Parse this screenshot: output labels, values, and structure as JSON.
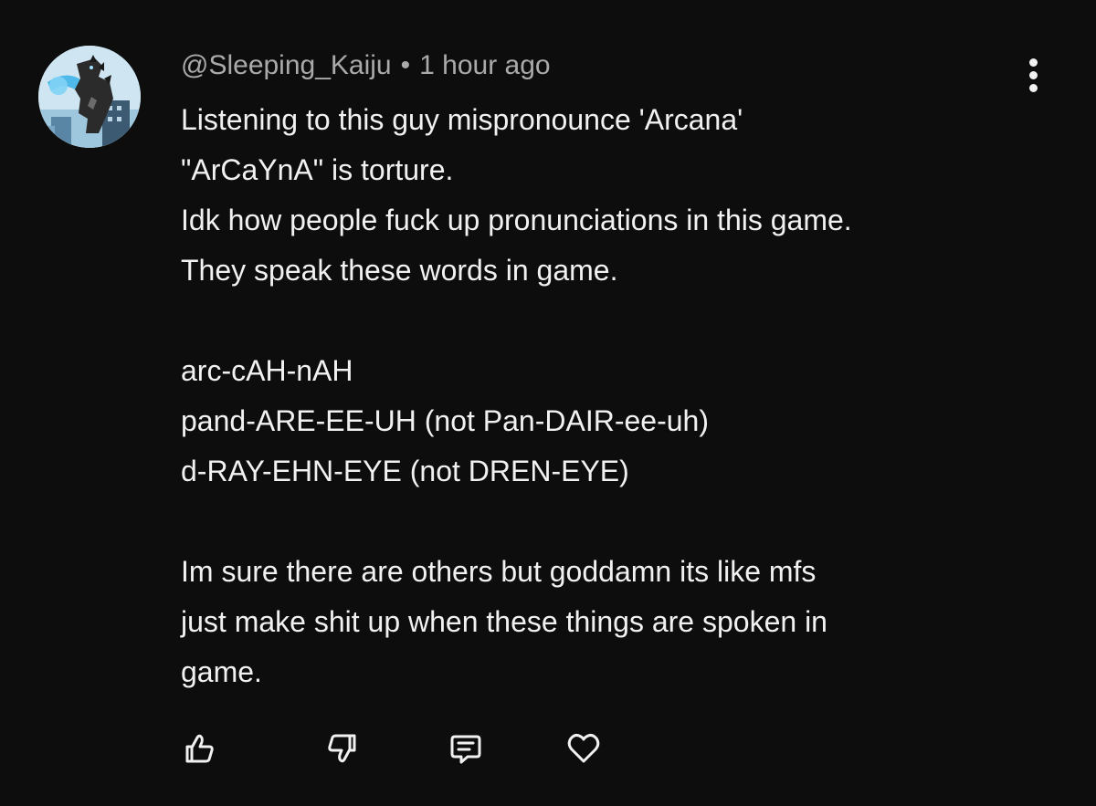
{
  "comment": {
    "author": "@Sleeping_Kaiju",
    "separator": "•",
    "timestamp": "1 hour ago",
    "avatar_icon": "kaiju-avatar-icon",
    "lines": [
      "Listening to this guy mispronounce 'Arcana'",
      "\"ArCaYnA\" is torture.",
      "Idk how people fuck up pronunciations in this game.",
      "They speak these words in game.",
      "",
      "arc-cAH-nAH",
      "pand-ARE-EE-UH (not Pan-DAIR-ee-uh)",
      "d-RAY-EHN-EYE (not DREN-EYE)",
      "",
      "Im sure there are others but goddamn its like mfs",
      "just make shit up when these things are spoken in",
      "game."
    ]
  },
  "actions": [
    {
      "name": "like-button",
      "icon": "thumbs-up-icon"
    },
    {
      "name": "dislike-button",
      "icon": "thumbs-down-icon"
    },
    {
      "name": "reply-button",
      "icon": "comment-icon"
    },
    {
      "name": "heart-button",
      "icon": "heart-icon"
    }
  ],
  "colors": {
    "background": "#0d0d0d",
    "text": "#f1f1f1",
    "meta": "#aaaaaa"
  }
}
